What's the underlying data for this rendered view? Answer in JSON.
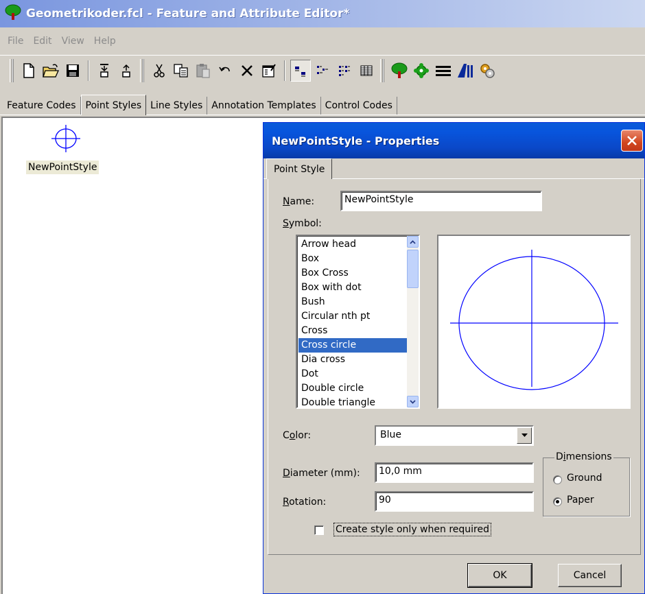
{
  "window": {
    "title": "Geometrikoder.fcl - Feature and Attribute Editor*"
  },
  "menu": [
    {
      "label": "File"
    },
    {
      "label": "Edit"
    },
    {
      "label": "View"
    },
    {
      "label": "Help"
    }
  ],
  "toolbar": {
    "buttons": [
      {
        "icon": "new-file-icon"
      },
      {
        "icon": "open-folder-icon"
      },
      {
        "icon": "save-icon"
      },
      {
        "icon": "import-icon"
      },
      {
        "icon": "export-icon"
      },
      {
        "icon": "cut-icon"
      },
      {
        "icon": "copy-icon"
      },
      {
        "icon": "paste-icon"
      },
      {
        "icon": "undo-icon"
      },
      {
        "icon": "delete-icon"
      },
      {
        "icon": "properties-icon"
      },
      {
        "icon": "large-icons-view-icon",
        "pressed": true
      },
      {
        "icon": "small-icons-view-icon"
      },
      {
        "icon": "list-view-icon"
      },
      {
        "icon": "details-view-icon"
      },
      {
        "icon": "feature-code-icon"
      },
      {
        "icon": "point-style-icon"
      },
      {
        "icon": "line-style-icon"
      },
      {
        "icon": "annotation-icon"
      },
      {
        "icon": "control-code-icon"
      }
    ]
  },
  "tabs": [
    {
      "label": "Feature Codes",
      "active": false
    },
    {
      "label": "Point Styles",
      "active": true
    },
    {
      "label": "Line Styles",
      "active": false
    },
    {
      "label": "Annotation Templates",
      "active": false
    },
    {
      "label": "Control Codes",
      "active": false
    }
  ],
  "workspace": {
    "items": [
      {
        "label": "NewPointStyle",
        "icon": "cross-circle-icon"
      }
    ]
  },
  "dialog": {
    "title": "NewPointStyle - Properties",
    "tab": "Point Style",
    "name_label_u": "N",
    "name_label_rest": "ame:",
    "name_value": "NewPointStyle",
    "symbol_label_u": "S",
    "symbol_label_rest": "ymbol:",
    "symbols": [
      "Arrow head",
      "Box",
      "Box Cross",
      "Box with dot",
      "Bush",
      "Circular nth pt",
      "Cross",
      "Cross circle",
      "Dia cross",
      "Dot",
      "Double circle",
      "Double triangle"
    ],
    "selected_symbol": "Cross circle",
    "color_label_pre": "C",
    "color_label_u": "o",
    "color_label_rest": "lor:",
    "color_value": "Blue",
    "symbol_color": "#0000ff",
    "diameter_label_u": "D",
    "diameter_label_rest": "iameter (mm):",
    "diameter_value": "10,0 mm",
    "rotation_label_u": "R",
    "rotation_label_rest": "otation:",
    "rotation_value": "90",
    "dimensions_label_pre": "D",
    "dimensions_label_u": "i",
    "dimensions_label_rest": "mensions",
    "radio_ground": "Ground",
    "radio_paper": "Paper",
    "dimensions_selected": "Paper",
    "checkbox_label": "Create style only when required",
    "checkbox_checked": false,
    "ok_label": "OK",
    "cancel_label": "Cancel"
  }
}
